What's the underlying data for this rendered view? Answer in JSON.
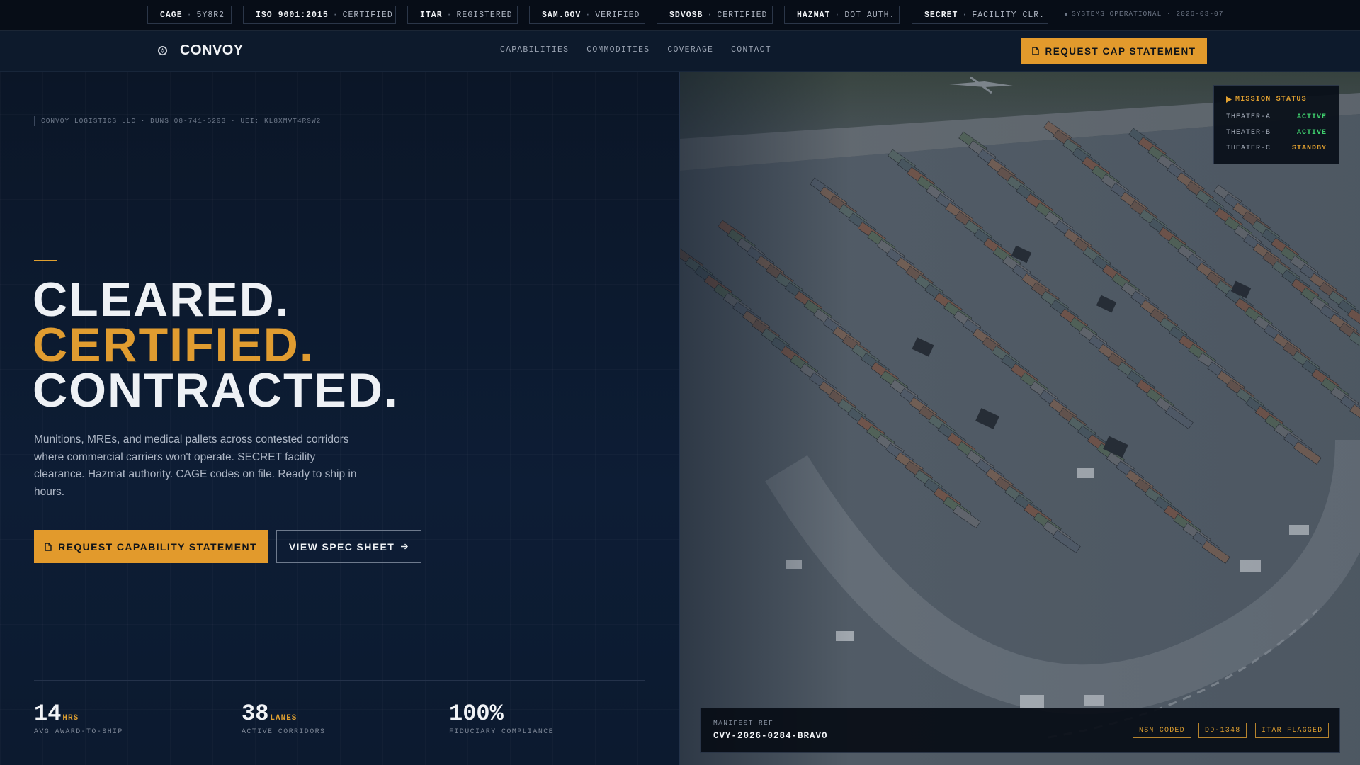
{
  "topbar": {
    "chips": [
      {
        "key": "CAGE",
        "value": "5Y8R2"
      },
      {
        "key": "ISO 9001:2015",
        "value": "CERTIFIED"
      },
      {
        "key": "ITAR",
        "value": "REGISTERED"
      },
      {
        "key": "SAM.GOV",
        "value": "VERIFIED"
      },
      {
        "key": "SDVOSB",
        "value": "CERTIFIED"
      },
      {
        "key": "HAZMAT",
        "value": "DOT AUTH."
      },
      {
        "key": "SECRET",
        "value": "FACILITY CLR."
      }
    ],
    "status": "SYSTEMS OPERATIONAL · 2026-03-07",
    "separator": "·"
  },
  "header": {
    "brand": "CONVOY",
    "nav": [
      "CAPABILITIES",
      "COMMODITIES",
      "COVERAGE",
      "CONTACT"
    ],
    "cta": "REQUEST CAP STATEMENT"
  },
  "hero": {
    "legal": "CONVOY LOGISTICS LLC · DUNS 08-741-5293 · UEI: KL8XMVT4R9W2",
    "headline": [
      "CLEARED.",
      "CERTIFIED.",
      "CONTRACTED."
    ],
    "lede": "Munitions, MREs, and medical pallets across contested corridors where commercial carriers won't operate. SECRET facility clearance. Hazmat authority. CAGE codes on file. Ready to ship in hours.",
    "primary_cta": "REQUEST CAPABILITY STATEMENT",
    "secondary_cta": "VIEW SPEC SHEET"
  },
  "stats": [
    {
      "value": "14",
      "unit": "HRS",
      "label": "AVG AWARD-TO-SHIP"
    },
    {
      "value": "38",
      "unit": "LANES",
      "label": "ACTIVE CORRIDORS"
    },
    {
      "value": "100%",
      "unit": "",
      "label": "FIDUCIARY COMPLIANCE"
    }
  ],
  "mission": {
    "title": "MISSION STATUS",
    "rows": [
      {
        "theater": "THEATER-A",
        "status": "ACTIVE",
        "color": "#3fcf6e"
      },
      {
        "theater": "THEATER-B",
        "status": "ACTIVE",
        "color": "#3fcf6e"
      },
      {
        "theater": "THEATER-C",
        "status": "STANDBY",
        "color": "#e0a030"
      }
    ]
  },
  "manifest": {
    "label": "MANIFEST REF",
    "ref": "CVY-2026-0284-BRAVO",
    "tags": [
      "NSN CODED",
      "DD-1348",
      "ITAR FLAGGED"
    ]
  },
  "colors": {
    "accent": "#e29a2c",
    "bg": "#0b1626",
    "active": "#3fcf6e"
  },
  "icons": {
    "logo": "emblem-icon",
    "doc": "document-icon",
    "arrow": "arrow-right-icon"
  }
}
